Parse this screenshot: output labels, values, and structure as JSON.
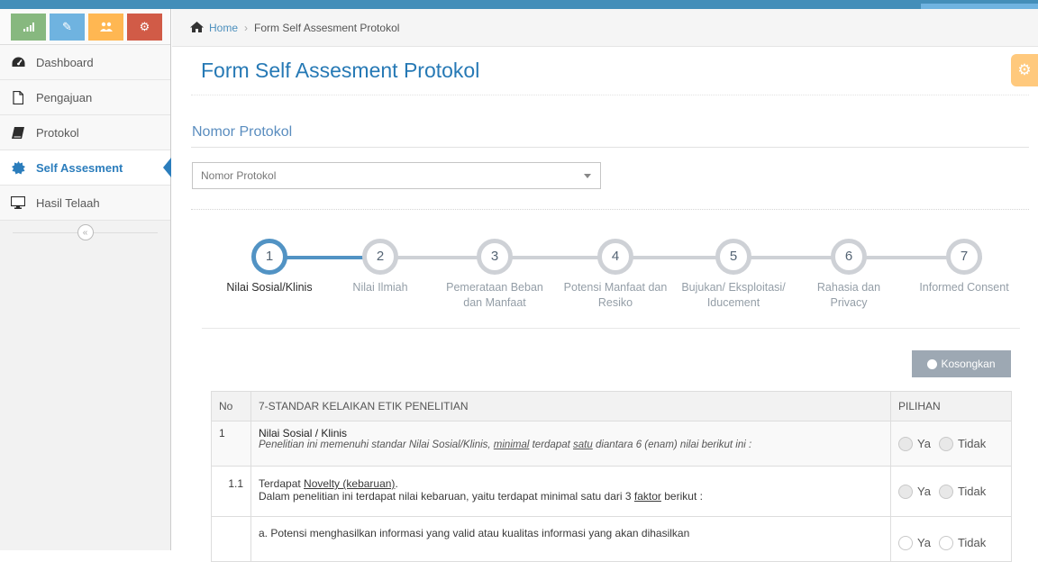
{
  "shortcuts": [
    "signal-icon",
    "pencil-icon",
    "users-icon",
    "cogs-icon"
  ],
  "sidebar": {
    "items": [
      {
        "label": "Dashboard",
        "icon": "tachometer-icon"
      },
      {
        "label": "Pengajuan",
        "icon": "file-icon"
      },
      {
        "label": "Protokol",
        "icon": "book-icon"
      },
      {
        "label": "Self Assesment",
        "icon": "certificate-icon",
        "active": true
      },
      {
        "label": "Hasil Telaah",
        "icon": "desktop-icon"
      }
    ],
    "collapse_icon": "«"
  },
  "breadcrumb": {
    "home": "Home",
    "current": "Form Self Assesment Protokol"
  },
  "page": {
    "title": "Form Self Assesment Protokol",
    "section_label": "Nomor Protokol",
    "select_placeholder": "Nomor Protokol"
  },
  "wizard": {
    "active_step": 1,
    "steps": [
      {
        "num": "1",
        "label": "Nilai Sosial/Klinis"
      },
      {
        "num": "2",
        "label": "Nilai Ilmiah"
      },
      {
        "num": "3",
        "label": "Pemerataan Beban dan Manfaat"
      },
      {
        "num": "4",
        "label": "Potensi Manfaat dan Resiko"
      },
      {
        "num": "5",
        "label": "Bujukan/ Eksploitasi/ Iducement"
      },
      {
        "num": "6",
        "label": "Rahasia dan Privacy"
      },
      {
        "num": "7",
        "label": "Informed Consent"
      }
    ]
  },
  "kosongkan_label": "Kosongkan",
  "table": {
    "headers": [
      "No",
      "7-STANDAR KELAIKAN ETIK PENELITIAN",
      "PILIHAN"
    ],
    "option_ya": "Ya",
    "option_tidak": "Tidak",
    "rows": [
      {
        "no": "1",
        "title": "Nilai Sosial / Klinis",
        "desc_parts": [
          "Penelitian ini memenuhi standar Nilai Sosial/Klinis, ",
          "minimal",
          " terdapat ",
          "satu",
          " diantara 6 (enam) nilai berikut ini :"
        ]
      },
      {
        "no": "1.1",
        "title_parts": [
          "Terdapat ",
          "Novelty (kebaruan)",
          "."
        ],
        "desc_parts": [
          "Dalam penelitian ini terdapat nilai kebaruan, yaitu terdapat minimal satu dari 3 ",
          "faktor",
          " berikut :"
        ]
      },
      {
        "no": "",
        "text": "a. Potensi menghasilkan informasi yang valid atau kualitas informasi yang akan dihasilkan"
      }
    ]
  },
  "colors": {
    "accent": "#2679b5",
    "active_step": "#5293c4",
    "settings": "#ffb752"
  }
}
